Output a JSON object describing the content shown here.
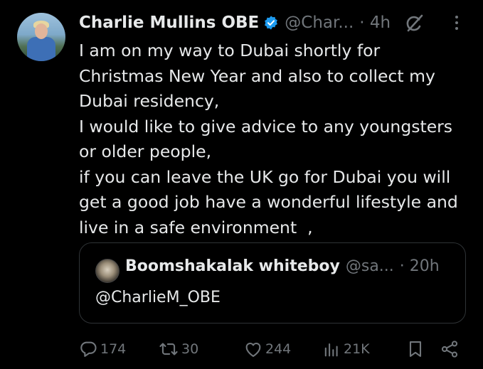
{
  "tweet": {
    "author_name": "Charlie Mullins OBE",
    "author_handle": "@Char...",
    "timestamp": "· 4h",
    "text": "I am on my way to Dubai shortly for\nChristmas New Year and also to collect my\nDubai residency,\nI would like to give advice to any youngsters\nor older people,\nif you can leave the UK go for Dubai you will\nget a good job have a wonderful lifestyle and\nlive in a safe environment  ,"
  },
  "quoted_tweet": {
    "author_name": "Boomshakalak whiteboy",
    "author_handle": "@sa...",
    "timestamp": "· 20h",
    "text": "@CharlieM_OBE"
  },
  "actions": {
    "replies": "174",
    "reposts": "30",
    "likes": "244",
    "views": "21K"
  },
  "colors": {
    "background": "#000000",
    "text": "#e7e9ea",
    "muted": "#71767b",
    "verified": "#1d9bf0",
    "border": "#2f3336"
  },
  "icons": [
    "verified-badge-icon",
    "grok-icon",
    "more-icon",
    "reply-icon",
    "repost-icon",
    "like-icon",
    "views-icon",
    "bookmark-icon",
    "share-icon"
  ]
}
